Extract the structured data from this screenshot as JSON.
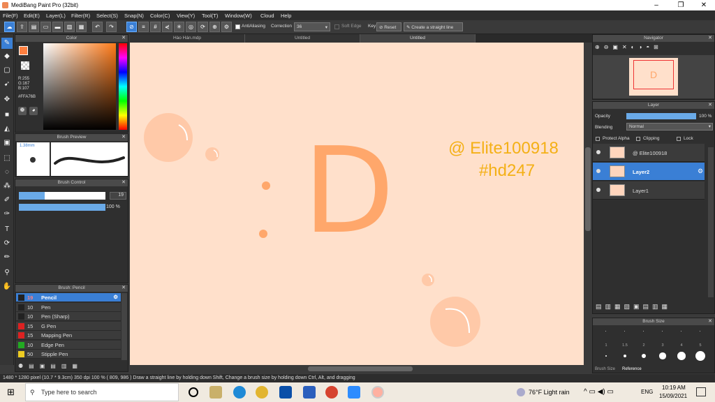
{
  "window": {
    "title": "MediBang Paint Pro (32bit)"
  },
  "menu": [
    "File(F)",
    "Edit(E)",
    "Layer(L)",
    "Filter(R)",
    "Select(S)",
    "Snap(N)",
    "Color(C)",
    "View(Y)",
    "Tool(T)",
    "Window(W)",
    "Cloud",
    "Help"
  ],
  "toolbar": {
    "antialiasing": "AntiAliasing",
    "correction_label": "Correction",
    "correction_value": "36",
    "soft_edge": "Soft Edge",
    "key": "Key",
    "reset": "Reset",
    "straight_line": "Create a straight line"
  },
  "color_panel": {
    "title": "Color",
    "r": "R:255",
    "g": "G:167",
    "b": "B:107",
    "hex": "#FFA76B",
    "fg_color": "#ff8040"
  },
  "brush_preview": {
    "title": "Brush Preview",
    "size": "1.38mm"
  },
  "brush_control": {
    "title": "Brush Control",
    "size_value": "19",
    "opacity_value": "100 %",
    "size_fill": 0.3
  },
  "brush_list": {
    "title": "Brush: Pencil",
    "items": [
      {
        "size": "19",
        "name": "Pencil",
        "color": "#222222",
        "selected": true
      },
      {
        "size": "10",
        "name": "Pen",
        "color": "#222222"
      },
      {
        "size": "10",
        "name": "Pen (Sharp)",
        "color": "#222222"
      },
      {
        "size": "15",
        "name": "G Pen",
        "color": "#dd2222"
      },
      {
        "size": "15",
        "name": "Mapping Pen",
        "color": "#dd2222"
      },
      {
        "size": "10",
        "name": "Edge Pen",
        "color": "#22aa22"
      },
      {
        "size": "50",
        "name": "Stipple Pen",
        "color": "#eecc22"
      }
    ]
  },
  "tabs": [
    "Hào Hán.mdp",
    "Untitled",
    "Untitled"
  ],
  "canvas": {
    "letter": "D",
    "watermark_line1": "@ Elite100918",
    "watermark_line2": "#hd247"
  },
  "navigator": {
    "title": "Navigator"
  },
  "layer_panel": {
    "title": "Layer",
    "opacity_label": "Opacity",
    "opacity_value": "100 %",
    "blending_label": "Blending",
    "blending_value": "Normal",
    "protect_alpha": "Protect Alpha",
    "clipping": "Clipping",
    "lock": "Lock",
    "layers": [
      {
        "name": "@ Elite100918",
        "selected": false
      },
      {
        "name": "Layer2",
        "selected": true
      },
      {
        "name": "Layer1",
        "selected": false
      }
    ]
  },
  "brush_size_panel": {
    "title": "Brush Size",
    "labels": [
      "1",
      "1.5",
      "2",
      "3",
      "4",
      "5"
    ],
    "tabs": [
      "Brush Size",
      "Reference"
    ]
  },
  "status": {
    "text": "1480 * 1280 pixel   (10.7 * 9.3cm)   350 dpi   100 %   ( 809, 986 )   Draw a straight line by holding down Shift, Change a brush size by holding down Ctrl, Alt, and dragging"
  },
  "taskbar": {
    "search_placeholder": "Type here to search",
    "weather": "76°F  Light rain",
    "lang": "ENG",
    "time": "10:19 AM",
    "date": "15/09/2021"
  }
}
